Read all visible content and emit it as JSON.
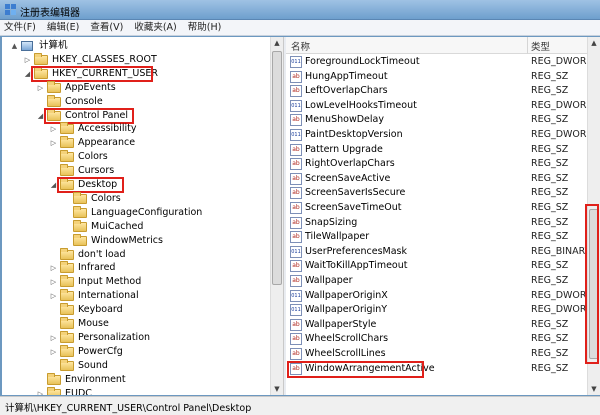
{
  "window": {
    "title": "注册表编辑器"
  },
  "menu": [
    "文件(F)",
    "编辑(E)",
    "查看(V)",
    "收藏夹(A)",
    "帮助(H)"
  ],
  "tree": [
    {
      "label": "计算机",
      "level": 0,
      "exp": "▲",
      "icon": "computer-icon"
    },
    {
      "label": "HKEY_CLASSES_ROOT",
      "level": 1,
      "exp": "▷",
      "icon": "folder-icon"
    },
    {
      "label": "HKEY_CURRENT_USER",
      "level": 1,
      "exp": "◢",
      "icon": "folder-icon",
      "hl": true
    },
    {
      "label": "AppEvents",
      "level": 2,
      "exp": "▷",
      "icon": "folder-icon"
    },
    {
      "label": "Console",
      "level": 2,
      "exp": "",
      "icon": "folder-icon"
    },
    {
      "label": "Control Panel",
      "level": 2,
      "exp": "◢",
      "icon": "folder-icon",
      "hl": true
    },
    {
      "label": "Accessibility",
      "level": 3,
      "exp": "▷",
      "icon": "folder-icon"
    },
    {
      "label": "Appearance",
      "level": 3,
      "exp": "▷",
      "icon": "folder-icon"
    },
    {
      "label": "Colors",
      "level": 3,
      "exp": "",
      "icon": "folder-icon"
    },
    {
      "label": "Cursors",
      "level": 3,
      "exp": "",
      "icon": "folder-icon"
    },
    {
      "label": "Desktop",
      "level": 3,
      "exp": "◢",
      "icon": "folder-icon",
      "hl": true
    },
    {
      "label": "Colors",
      "level": 4,
      "exp": "",
      "icon": "folder-icon"
    },
    {
      "label": "LanguageConfiguration",
      "level": 4,
      "exp": "",
      "icon": "folder-icon"
    },
    {
      "label": "MuiCached",
      "level": 4,
      "exp": "",
      "icon": "folder-icon"
    },
    {
      "label": "WindowMetrics",
      "level": 4,
      "exp": "",
      "icon": "folder-icon"
    },
    {
      "label": "don't load",
      "level": 3,
      "exp": "",
      "icon": "folder-icon"
    },
    {
      "label": "Infrared",
      "level": 3,
      "exp": "▷",
      "icon": "folder-icon"
    },
    {
      "label": "Input Method",
      "level": 3,
      "exp": "▷",
      "icon": "folder-icon"
    },
    {
      "label": "International",
      "level": 3,
      "exp": "▷",
      "icon": "folder-icon"
    },
    {
      "label": "Keyboard",
      "level": 3,
      "exp": "",
      "icon": "folder-icon"
    },
    {
      "label": "Mouse",
      "level": 3,
      "exp": "",
      "icon": "folder-icon"
    },
    {
      "label": "Personalization",
      "level": 3,
      "exp": "▷",
      "icon": "folder-icon"
    },
    {
      "label": "PowerCfg",
      "level": 3,
      "exp": "▷",
      "icon": "folder-icon"
    },
    {
      "label": "Sound",
      "level": 3,
      "exp": "",
      "icon": "folder-icon"
    },
    {
      "label": "Environment",
      "level": 2,
      "exp": "",
      "icon": "folder-icon"
    },
    {
      "label": "EUDC",
      "level": 2,
      "exp": "▷",
      "icon": "folder-icon"
    }
  ],
  "values_header": {
    "name": "名称",
    "type": "类型"
  },
  "values": [
    {
      "name": "ForegroundLockTimeout",
      "type": "REG_DWORD",
      "kind": "bin"
    },
    {
      "name": "HungAppTimeout",
      "type": "REG_SZ",
      "kind": "sz"
    },
    {
      "name": "LeftOverlapChars",
      "type": "REG_SZ",
      "kind": "sz"
    },
    {
      "name": "LowLevelHooksTimeout",
      "type": "REG_DWORD",
      "kind": "bin"
    },
    {
      "name": "MenuShowDelay",
      "type": "REG_SZ",
      "kind": "sz"
    },
    {
      "name": "PaintDesktopVersion",
      "type": "REG_DWORD",
      "kind": "bin"
    },
    {
      "name": "Pattern Upgrade",
      "type": "REG_SZ",
      "kind": "sz"
    },
    {
      "name": "RightOverlapChars",
      "type": "REG_SZ",
      "kind": "sz"
    },
    {
      "name": "ScreenSaveActive",
      "type": "REG_SZ",
      "kind": "sz"
    },
    {
      "name": "ScreenSaverIsSecure",
      "type": "REG_SZ",
      "kind": "sz"
    },
    {
      "name": "ScreenSaveTimeOut",
      "type": "REG_SZ",
      "kind": "sz"
    },
    {
      "name": "SnapSizing",
      "type": "REG_SZ",
      "kind": "sz"
    },
    {
      "name": "TileWallpaper",
      "type": "REG_SZ",
      "kind": "sz"
    },
    {
      "name": "UserPreferencesMask",
      "type": "REG_BINARY",
      "kind": "bin"
    },
    {
      "name": "WaitToKillAppTimeout",
      "type": "REG_SZ",
      "kind": "sz"
    },
    {
      "name": "Wallpaper",
      "type": "REG_SZ",
      "kind": "sz"
    },
    {
      "name": "WallpaperOriginX",
      "type": "REG_DWORD",
      "kind": "bin"
    },
    {
      "name": "WallpaperOriginY",
      "type": "REG_DWORD",
      "kind": "bin"
    },
    {
      "name": "WallpaperStyle",
      "type": "REG_SZ",
      "kind": "sz"
    },
    {
      "name": "WheelScrollChars",
      "type": "REG_SZ",
      "kind": "sz"
    },
    {
      "name": "WheelScrollLines",
      "type": "REG_SZ",
      "kind": "sz"
    },
    {
      "name": "WindowArrangementActive",
      "type": "REG_SZ",
      "kind": "sz",
      "hl": true
    }
  ],
  "status": {
    "path": "计算机\\HKEY_CURRENT_USER\\Control Panel\\Desktop"
  },
  "colors": {
    "highlight": "#e0201a",
    "titlebar": "#6e9fcd"
  }
}
